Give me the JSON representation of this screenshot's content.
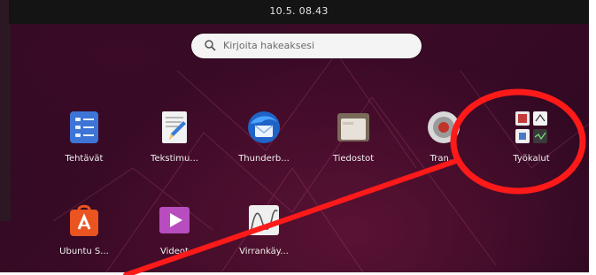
{
  "topbar": {
    "clock": "10.5. 08.43"
  },
  "search": {
    "placeholder": "Kirjoita hakeaksesi"
  },
  "apps": [
    {
      "label": "Tehtävät",
      "icon": "checklist-icon"
    },
    {
      "label": "Tekstimu...",
      "icon": "text-editor-icon"
    },
    {
      "label": "Thunderb...",
      "icon": "thunderbird-icon"
    },
    {
      "label": "Tiedostot",
      "icon": "folder-icon"
    },
    {
      "label": "Tran...",
      "icon": "transmission-icon"
    },
    {
      "label": "Työkalut",
      "icon": "utilities-folder-icon"
    },
    {
      "label": "Ubuntu S...",
      "icon": "ubuntu-software-icon"
    },
    {
      "label": "Videot",
      "icon": "videos-icon"
    },
    {
      "label": "Virrankäy...",
      "icon": "power-statistics-icon"
    }
  ],
  "annotation": {
    "color": "#ff1a1a"
  }
}
